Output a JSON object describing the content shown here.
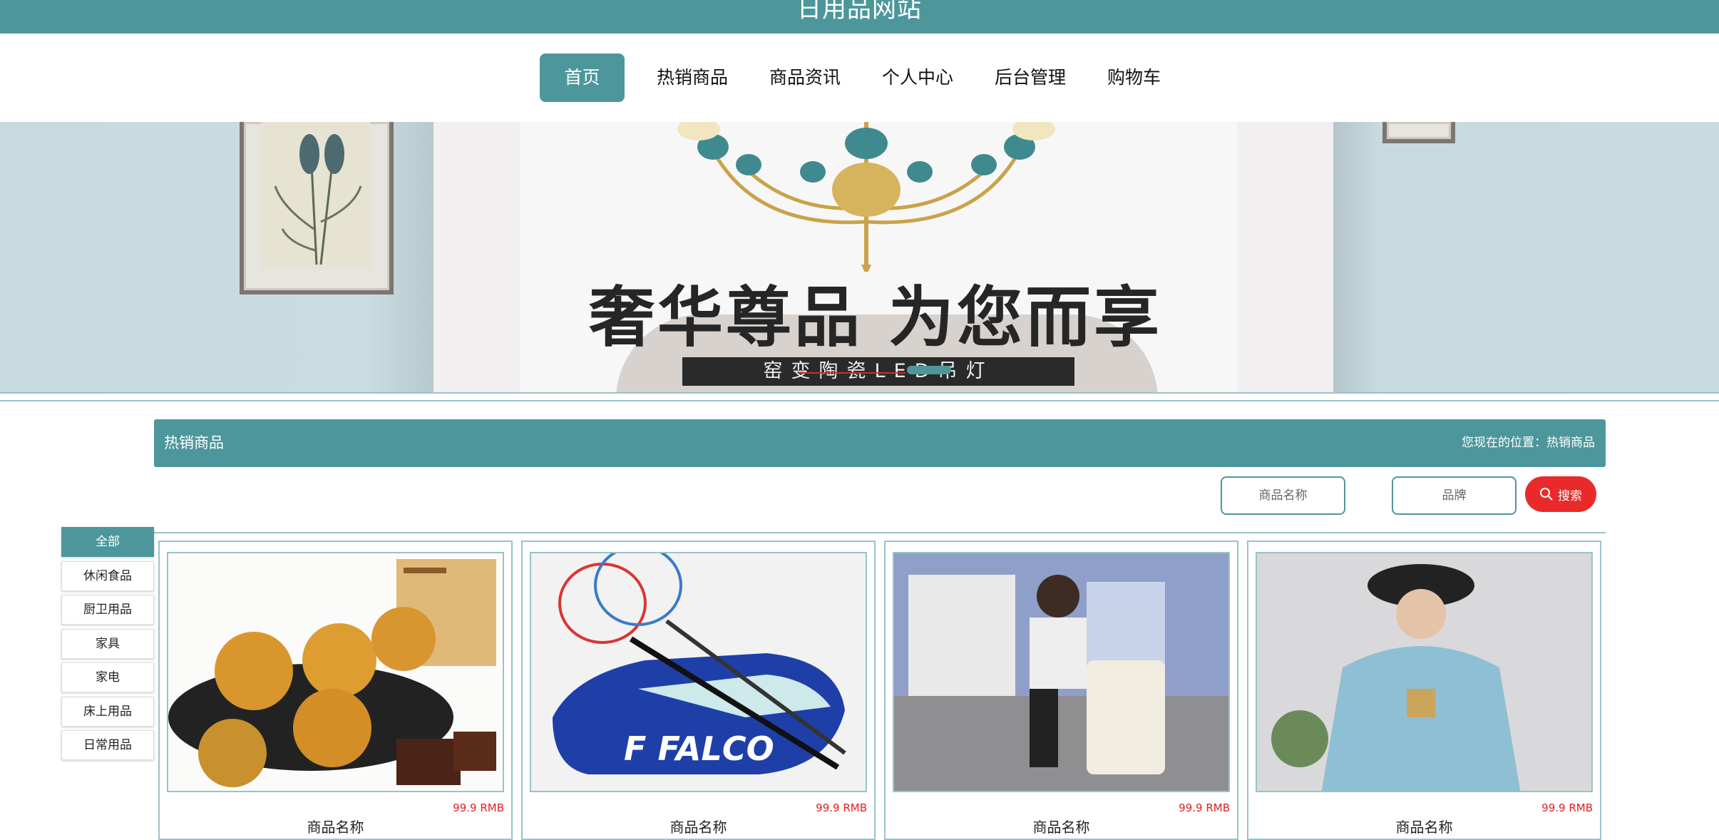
{
  "header": {
    "site_title": "日用品网站"
  },
  "nav": {
    "items": [
      {
        "label": "首页",
        "active": true
      },
      {
        "label": "热销商品",
        "active": false
      },
      {
        "label": "商品资讯",
        "active": false
      },
      {
        "label": "个人中心",
        "active": false
      },
      {
        "label": "后台管理",
        "active": false
      },
      {
        "label": "购物车",
        "active": false
      }
    ]
  },
  "banner": {
    "headline": "奢华尊品 为您而享",
    "caption": "窑变陶瓷LED吊灯"
  },
  "section": {
    "title": "热销商品",
    "breadcrumb": "您现在的位置：热销商品"
  },
  "search": {
    "name_placeholder": "商品名称",
    "brand_placeholder": "品牌",
    "button_label": "搜索",
    "button_icon": "search-icon"
  },
  "categories": [
    "全部",
    "休闲食品",
    "厨卫用品",
    "家具",
    "家电",
    "床上用品",
    "日常用品"
  ],
  "products": [
    {
      "price": "99.9 RMB",
      "name": "商品名称"
    },
    {
      "price": "99.9 RMB",
      "name": "商品名称"
    },
    {
      "price": "99.9 RMB",
      "name": "商品名称"
    },
    {
      "price": "99.9 RMB",
      "name": "商品名称"
    }
  ],
  "colors": {
    "accent": "#4d979c",
    "price": "#e02020",
    "search_button": "#ea2a2a"
  }
}
